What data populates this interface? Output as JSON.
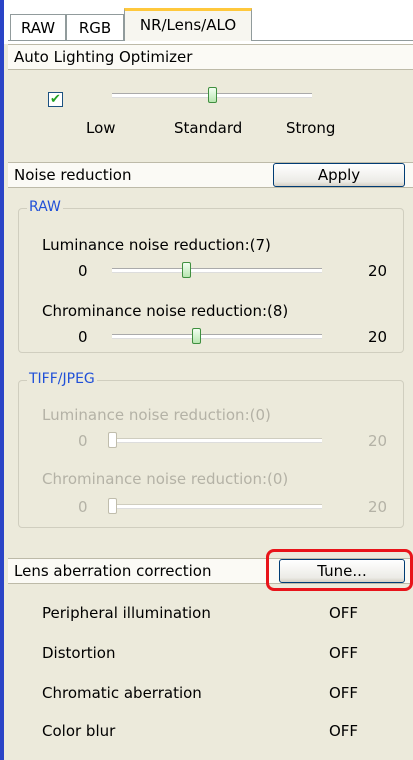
{
  "tabs": [
    "RAW",
    "RGB",
    "NR/Lens/ALO"
  ],
  "alo": {
    "header": "Auto Lighting Optimizer",
    "checkbox_mark": "✔",
    "labels": [
      "Low",
      "Standard",
      "Strong"
    ],
    "level": 0.5
  },
  "noise": {
    "header": "Noise reduction",
    "apply_label": "Apply",
    "raw_group": {
      "title": "RAW",
      "luminance_label": "Luminance noise reduction:(7)",
      "luminance_min": "0",
      "luminance_max": "20",
      "luminance_value": 7,
      "chrominance_label": "Chrominance noise reduction:(8)",
      "chrominance_min": "0",
      "chrominance_max": "20",
      "chrominance_value": 8
    },
    "tiff_group": {
      "title": "TIFF/JPEG",
      "luminance_label": "Luminance noise reduction:(0)",
      "luminance_min": "0",
      "luminance_max": "20",
      "luminance_value": 0,
      "chrominance_label": "Chrominance noise reduction:(0)",
      "chrominance_min": "0",
      "chrominance_max": "20",
      "chrominance_value": 0
    }
  },
  "lens": {
    "header": "Lens aberration correction",
    "tune_label": "Tune...",
    "items": [
      {
        "label": "Peripheral illumination",
        "value": "OFF"
      },
      {
        "label": "Distortion",
        "value": "OFF"
      },
      {
        "label": "Chromatic aberration",
        "value": "OFF"
      },
      {
        "label": "Color blur",
        "value": "OFF"
      }
    ]
  }
}
